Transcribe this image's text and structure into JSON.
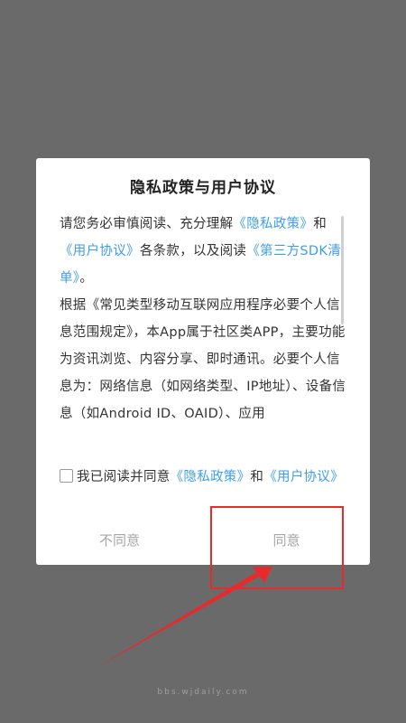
{
  "dialog": {
    "title": "隐私政策与用户协议",
    "content": {
      "p1": {
        "t1": "请您务必审慎阅读、充分理解",
        "link1": "《隐私政策》",
        "t2": "和",
        "link2": "《用户协议》",
        "t3": "各条款，以及阅读",
        "link3": "《第三方SDK清单》",
        "t4": "。"
      },
      "p2": "根据《常见类型移动互联网应用程序必要个人信息范围规定》，本App属于社区类APP，主要功能为资讯浏览、内容分享、即时通讯。必要个人信息为：网络信息（如网络类型、IP地址）、设备信息（如Android ID、OAID）、应用"
    },
    "agree_row": {
      "text": "我已阅读并同意",
      "link1": "《隐私政策》",
      "and": "和",
      "link2": "《用户协议》"
    },
    "buttons": {
      "disagree": "不同意",
      "agree": "同意"
    }
  },
  "watermark": "bbs.wjdaily.com",
  "colors": {
    "link": "#3f9ee8",
    "annotation": "#e82a2a",
    "overlay": "#6a6a6a"
  }
}
